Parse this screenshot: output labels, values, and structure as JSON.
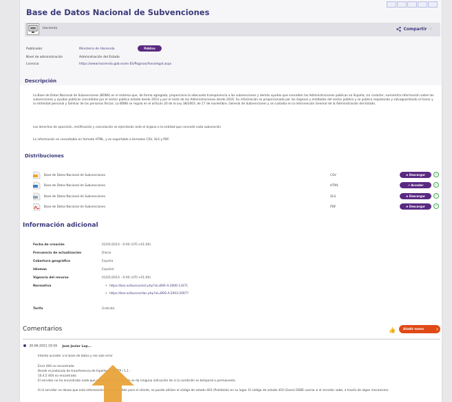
{
  "format_strip_count": 5,
  "dataset": {
    "title": "Base de Datos Nacional de Subvenciones",
    "publisher_short": "Hacienda",
    "share_label": "Compartir"
  },
  "meta": {
    "publisher_label": "Publicador",
    "publisher_value": "Ministerio de Hacienda",
    "access_badge": "Público",
    "admin_label": "Nivel de administración",
    "admin_value": "Administración del Estado",
    "license_label": "Licencia",
    "license_value": "https://www.hacienda.gob.es/es-ES/Paginas/Avisolegal.aspx"
  },
  "description": {
    "title": "Descripción",
    "paragraphs": [
      "La Base de Datos Nacional de Subvenciones (BDNS) es el sistema que, de forma agregada, proporciona la adecuada transparencia a las subvenciones y demás ayudas que conceden las Administraciones públicas en España; sin carácter, suministra información sobre las subvenciones y ayudas públicas concedidas por el sector público estatal desde 2014 y por el resto de las Administraciones desde 2016. Su información es proporcionada por los órganos y entidades del sector público y se publica respetando y salvaguardando el honor y la intimidad personal y familiar de las personas físicas. La BDNS se regula en el artículo 20 de la Ley 38/2003, de 17 de noviembre, General de Subvenciones y se custodia en la Intervención General de la Administración del Estado.",
      "Los derechos de oposición, rectificación y cancelación se ejercitarán ante el órgano o la entidad que concede cada subvención",
      "La información es consultable en formato HTML, y es exportable a formatos CSV, XLS y PDF."
    ]
  },
  "distributions": {
    "title": "Distribuciones",
    "items": [
      {
        "name": "Base de Datos Nacional de Subvenciones",
        "format": "CSV",
        "action": "⊕ Descargar",
        "icon": "csv-file-icon"
      },
      {
        "name": "Base de Datos Nacional de Subvenciones",
        "format": "HTML",
        "action": "↗ Acceder",
        "icon": "html-file-icon"
      },
      {
        "name": "Base de Datos Nacional de Subvenciones",
        "format": "XLS",
        "action": "⊕ Descargar",
        "icon": "xls-file-icon"
      },
      {
        "name": "Base de Datos Nacional de Subvenciones",
        "format": "PDF",
        "action": "⊕ Descargar",
        "icon": "pdf-file-icon"
      }
    ]
  },
  "info": {
    "title": "Información adicional",
    "rows": [
      {
        "k": "Fecha de creación",
        "v": "01/01/2014 - 0:00 (UTC+01:00)"
      },
      {
        "k": "Frecuencia de actualización",
        "v": "Diaria"
      },
      {
        "k": "Cobertura geográfica",
        "v": "España"
      },
      {
        "k": "Idiomas",
        "v": "Español"
      },
      {
        "k": "Vigencia del recurso",
        "v": "01/01/2014 - 0:00 (UTC+01:00)"
      },
      {
        "k": "Normativa",
        "v": ""
      }
    ],
    "normativa_links": [
      "https://boe.es/buscar/act.php?id=BOE-A-2006-13371",
      "https://boe.es/buscar/doc.php?id=BOE-A-2003-20977"
    ],
    "tarifa_label": "Tarifa",
    "tarifa_value": "Gratuita"
  },
  "comments": {
    "title": "Comentarios",
    "add_label": "Añadir nuevo comentario",
    "date": "20-06-2021 19:59",
    "author": "Jose Javier Lop...",
    "lines": [
      "Intento acceder a la base de datos y me sale error",
      "Error 404 no encontrado",
      "Desde el protocolo de transferencia de hipertexto (HTTP / 1.1 :",
      "10.4.5 404 no encontrado",
      "El servidor no ha encontrado nada que coincida con la URI. No se da ninguna indicación de si la condición es temporal o permanente.",
      "Si el servidor no desea que esta información esté disponible para el cliente, se puede utilizar el código de estado 403 (Prohibido) en su lugar. El código de estado 410 (Gone) DEBE usarse si el servidor sabe, a través de algún mecanismo"
    ]
  },
  "colors": {
    "brand": "#3c3a7a",
    "badge": "#5a2a82",
    "accent": "#e04a16",
    "ok": "#3aa84a"
  }
}
